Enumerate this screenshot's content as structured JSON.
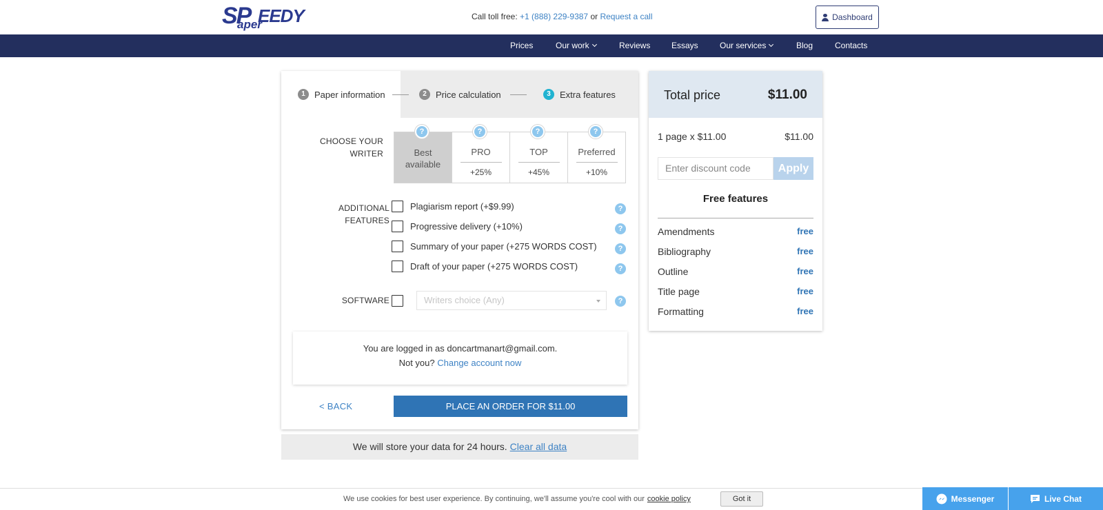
{
  "header": {
    "logo_big": "SP",
    "logo_rest": "EEDY",
    "logo_small": "aper",
    "tollfree_label": "Call toll free: ",
    "phone": "+1 (888) 229-9387",
    "or_text": "or",
    "request_call": "Request a call",
    "dashboard_label": "Dashboard"
  },
  "nav": {
    "items": [
      "Prices",
      "Our work",
      "Reviews",
      "Essays",
      "Our services",
      "Blog",
      "Contacts"
    ]
  },
  "steps": [
    {
      "num": "1",
      "label": "Paper information"
    },
    {
      "num": "2",
      "label": "Price calculation"
    },
    {
      "num": "3",
      "label": "Extra features"
    }
  ],
  "writer": {
    "section_label_1": "CHOOSE YOUR",
    "section_label_2": "WRITER",
    "help_glyph": "?",
    "options": [
      {
        "name_1": "Best",
        "name_2": "available",
        "pct": ""
      },
      {
        "name_1": "PRO",
        "name_2": "",
        "pct": "+25%"
      },
      {
        "name_1": "TOP",
        "name_2": "",
        "pct": "+45%"
      },
      {
        "name_1": "Preferred",
        "name_2": "",
        "pct": "+10%"
      }
    ],
    "selected_index": 0
  },
  "features": {
    "section_label_1": "ADDITIONAL",
    "section_label_2": "FEATURES",
    "items": [
      "Plagiarism report (+$9.99)",
      "Progressive delivery (+10%)",
      "Summary of your paper (+275 WORDS COST)",
      "Draft of your paper (+275 WORDS COST)"
    ]
  },
  "software": {
    "label": "SOFTWARE",
    "select_value": "Writers choice (Any)"
  },
  "login": {
    "line1": "You are logged in as doncartmanart@gmail.com.",
    "not_you": "Not you?",
    "change_link": "Change account now"
  },
  "actions": {
    "back": "< BACK",
    "place_order": "PLACE AN ORDER FOR $11.00"
  },
  "store": {
    "text": "We will store your data for 24 hours.",
    "clear_link": "Clear all data"
  },
  "price": {
    "title": "Total price",
    "total": "$11.00",
    "line_label": "1 page x $11.00",
    "line_value": "$11.00",
    "discount_placeholder": "Enter discount code",
    "apply": "Apply",
    "free_title": "Free features",
    "free_items": [
      {
        "label": "Amendments",
        "value": "free"
      },
      {
        "label": "Bibliography",
        "value": "free"
      },
      {
        "label": "Outline",
        "value": "free"
      },
      {
        "label": "Title page",
        "value": "free"
      },
      {
        "label": "Formatting",
        "value": "free"
      }
    ]
  },
  "cookie": {
    "text": "We use cookies for best user experience. By continuing, we'll assume you're cool with our",
    "policy_link": "cookie policy",
    "got_it": "Got it"
  },
  "chat": {
    "messenger": "Messenger",
    "live_chat": "Live Chat"
  },
  "colors": {
    "navy": "#232f5e",
    "accent_blue": "#2f74b5",
    "link_blue": "#3d82c4",
    "step_active": "#21b3d1",
    "chat_blue": "#47a2ec"
  }
}
